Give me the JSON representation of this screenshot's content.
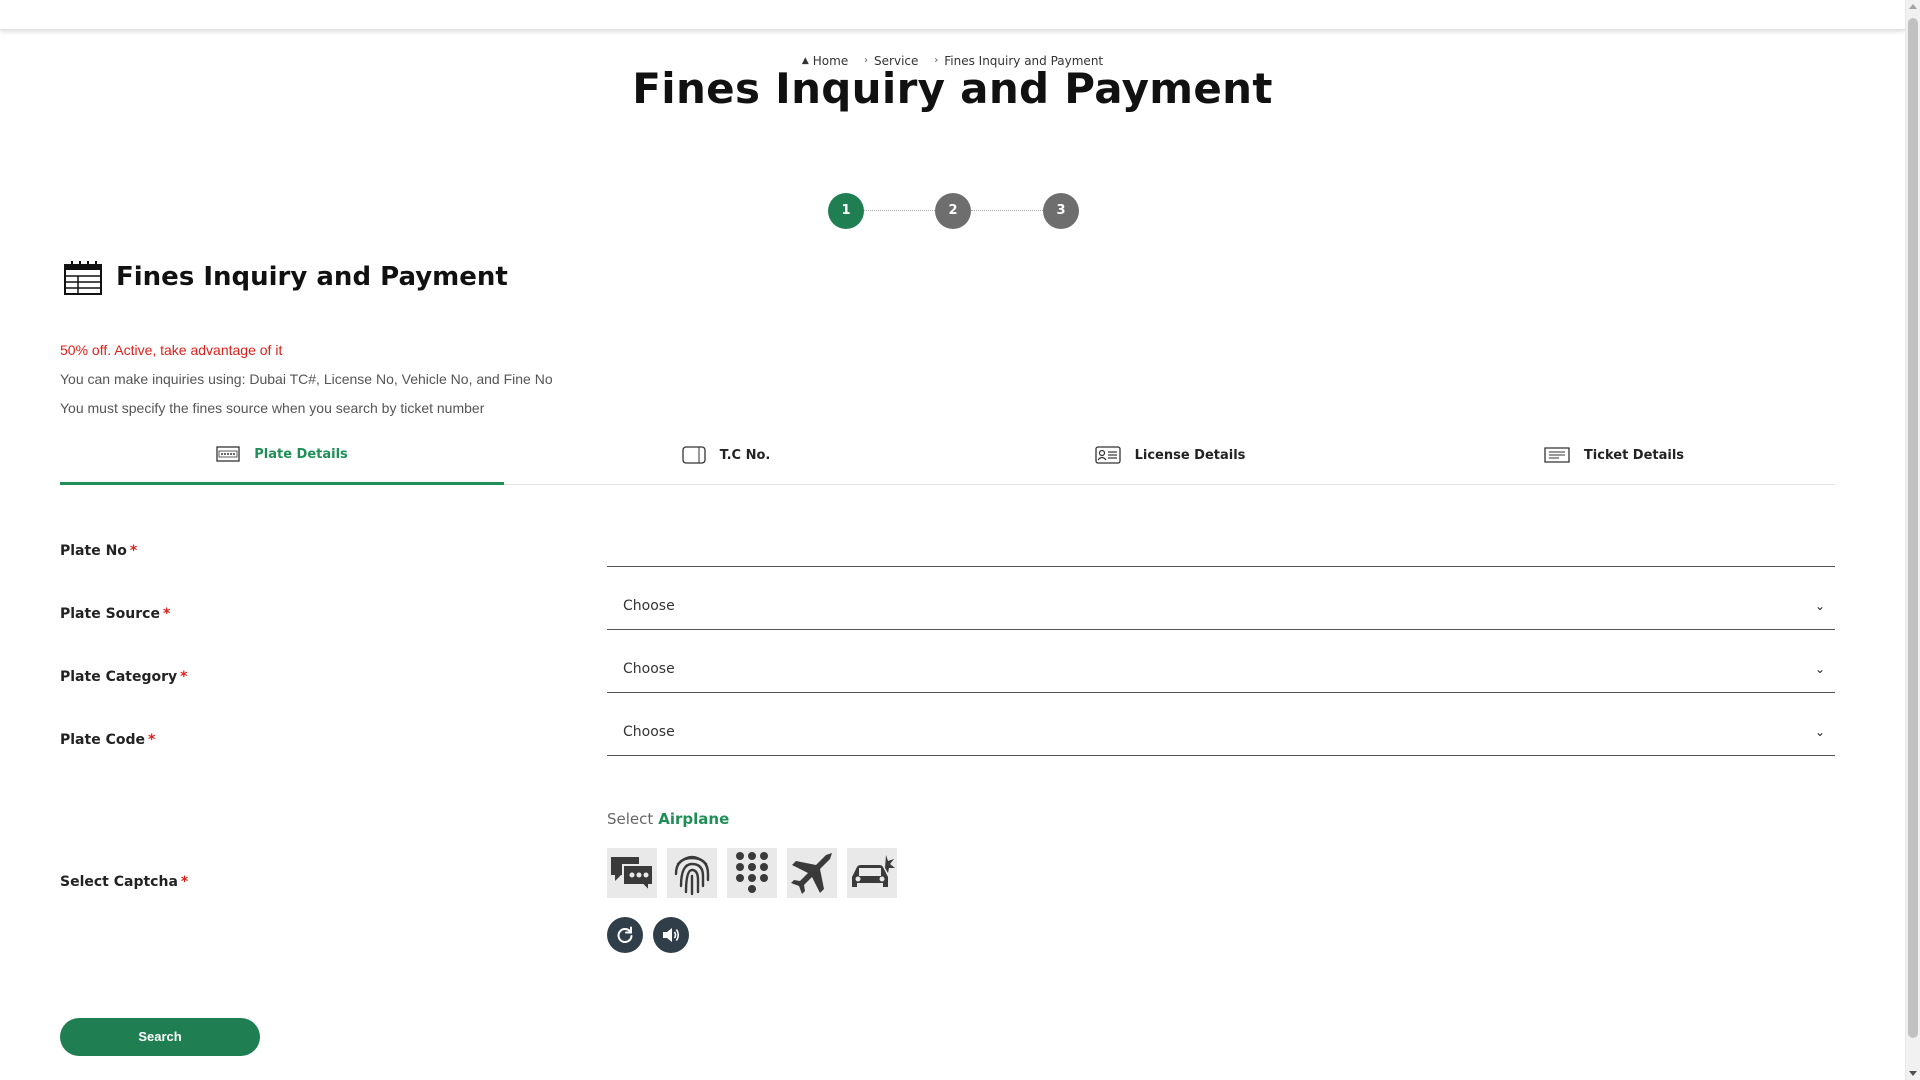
{
  "breadcrumb": {
    "home": "Home",
    "service": "Service",
    "current": "Fines Inquiry and Payment"
  },
  "page_title": "Fines Inquiry and Payment",
  "stepper": {
    "steps": [
      "1",
      "2",
      "3"
    ],
    "active_step": "1",
    "active_color": "#1f7f52",
    "inactive_color": "#6e6e6e"
  },
  "section": {
    "title": "Fines Inquiry and Payment",
    "icon": "calendar-list-icon"
  },
  "notes": {
    "promo": "50% off. Active, take advantage of it",
    "line1": "You can make inquiries using: Dubai TC#, License No, Vehicle No, and Fine No",
    "line2": "You must specify the fines source when you search by ticket number"
  },
  "tabs": [
    {
      "label": "Plate Details",
      "icon": "plate-icon",
      "active": true
    },
    {
      "label": "T.C No.",
      "icon": "card-icon",
      "active": false
    },
    {
      "label": "License Details",
      "icon": "license-icon",
      "active": false
    },
    {
      "label": "Ticket Details",
      "icon": "ticket-icon",
      "active": false
    }
  ],
  "form": {
    "plate_no": {
      "label": "Plate No",
      "required": "*",
      "value": ""
    },
    "plate_source": {
      "label": "Plate Source",
      "required": "*",
      "selected": "Choose"
    },
    "plate_category": {
      "label": "Plate Category",
      "required": "*",
      "selected": "Choose"
    },
    "plate_code": {
      "label": "Plate Code",
      "required": "*",
      "selected": "Choose"
    },
    "captcha": {
      "label": "Select Captcha",
      "required": "*"
    }
  },
  "captcha": {
    "prompt": "Select",
    "target": "Airplane",
    "options": [
      "chat-bubbles-icon",
      "fingerprint-icon",
      "dialpad-icon",
      "airplane-icon",
      "car-crash-icon"
    ]
  },
  "actions": {
    "refresh_icon": "refresh-icon",
    "audio_icon": "speaker-icon",
    "search_label": "Search"
  },
  "colors": {
    "accent": "#1f7f52",
    "required": "#e0201b",
    "dark_button": "#2f3e48"
  }
}
